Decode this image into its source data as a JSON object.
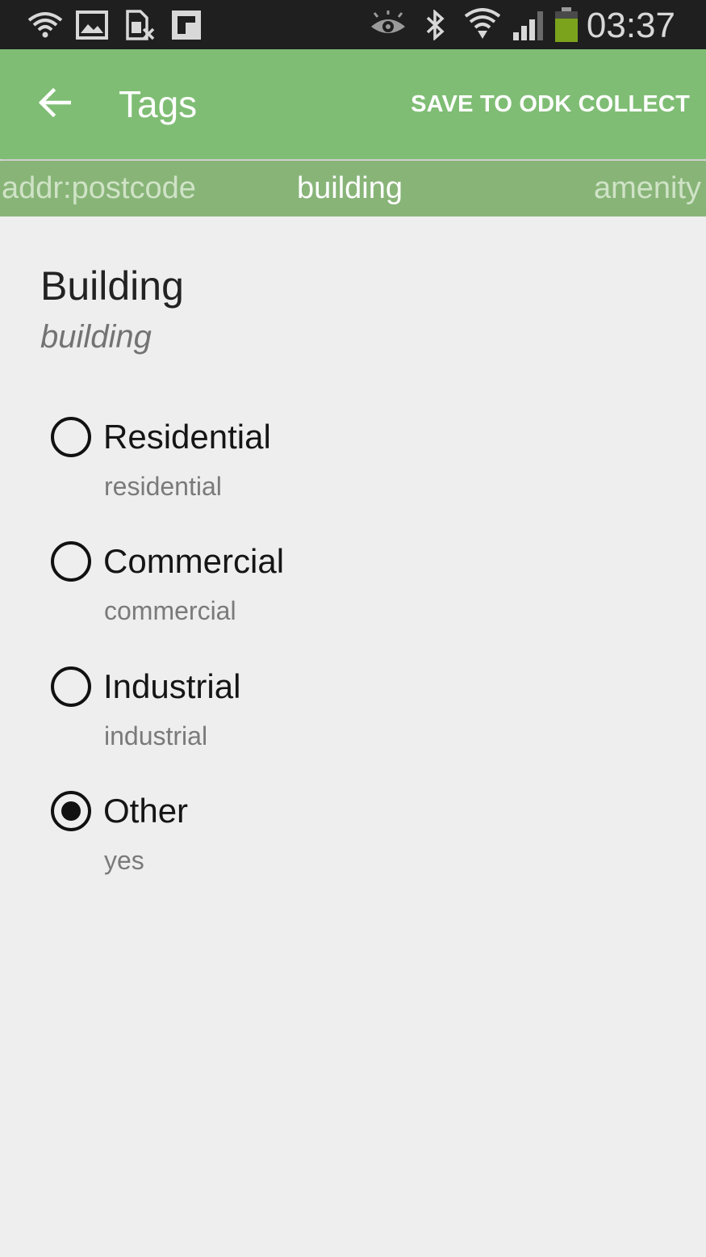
{
  "status_bar": {
    "time": "03:37",
    "icons": [
      "wifi-notification-icon",
      "image-icon",
      "sim-card-icon",
      "flipboard-icon",
      "eye-icon",
      "bluetooth-icon",
      "wifi-icon",
      "signal-icon",
      "battery-icon"
    ]
  },
  "app_bar": {
    "title": "Tags",
    "action_label": "SAVE TO ODK COLLECT",
    "back_icon": "arrow-back-icon"
  },
  "tabs": [
    {
      "label": "addr:postcode",
      "active": false
    },
    {
      "label": "building",
      "active": true
    },
    {
      "label": "amenity",
      "active": false
    }
  ],
  "section": {
    "title": "Building",
    "key": "building"
  },
  "options": [
    {
      "label": "Residential",
      "value": "residential",
      "selected": false
    },
    {
      "label": "Commercial",
      "value": "commercial",
      "selected": false
    },
    {
      "label": "Industrial",
      "value": "industrial",
      "selected": false
    },
    {
      "label": "Other",
      "value": "yes",
      "selected": true
    }
  ],
  "colors": {
    "app_bar": "#7fbd74",
    "tab_strip": "#88b478",
    "background": "#eeeeee",
    "status_bar": "#1f1f1f"
  }
}
